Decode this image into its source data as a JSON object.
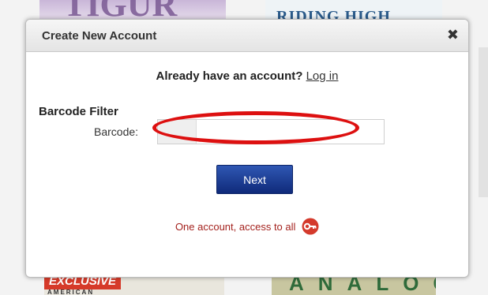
{
  "modal": {
    "title": "Create New Account",
    "close_symbol": "✖",
    "login_prompt": "Already have an account?",
    "login_link": "Log in",
    "section_title": "Barcode Filter",
    "barcode_label": "Barcode:",
    "barcode_value": "",
    "next_label": "Next",
    "tagline": "One account, access to all",
    "tagline_icon": "key-icon",
    "highlight_color": "#dd1010",
    "button_color": "#1e3f97",
    "tagline_color": "#a4221e"
  }
}
